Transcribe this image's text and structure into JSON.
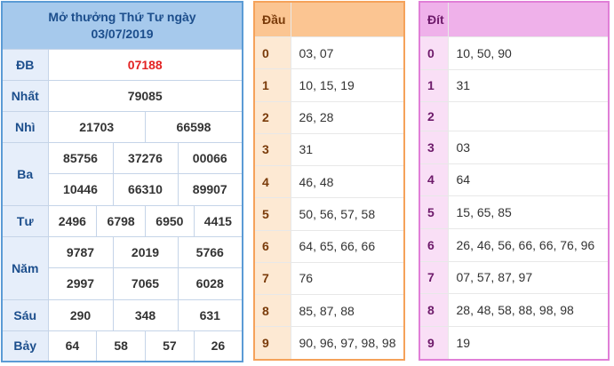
{
  "header": {
    "title_line1": "Mở thưởng Thứ Tư ngày",
    "title_line2": "03/07/2019"
  },
  "prizes": [
    {
      "label": "ĐB",
      "rows": [
        [
          "07188"
        ]
      ]
    },
    {
      "label": "Nhất",
      "rows": [
        [
          "79085"
        ]
      ]
    },
    {
      "label": "Nhì",
      "rows": [
        [
          "21703",
          "66598"
        ]
      ]
    },
    {
      "label": "Ba",
      "rows": [
        [
          "85756",
          "37276",
          "00066"
        ],
        [
          "10446",
          "66310",
          "89907"
        ]
      ]
    },
    {
      "label": "Tư",
      "rows": [
        [
          "2496",
          "6798",
          "6950",
          "4415"
        ]
      ]
    },
    {
      "label": "Năm",
      "rows": [
        [
          "9787",
          "2019",
          "5766"
        ],
        [
          "2997",
          "7065",
          "6028"
        ]
      ]
    },
    {
      "label": "Sáu",
      "rows": [
        [
          "290",
          "348",
          "631"
        ]
      ]
    },
    {
      "label": "Bảy",
      "rows": [
        [
          "64",
          "58",
          "57",
          "26"
        ]
      ]
    }
  ],
  "dau": {
    "title": "Đầu",
    "rows": [
      {
        "head": "0",
        "values": "03, 07"
      },
      {
        "head": "1",
        "values": "10, 15, 19"
      },
      {
        "head": "2",
        "values": "26, 28"
      },
      {
        "head": "3",
        "values": "31"
      },
      {
        "head": "4",
        "values": "46, 48"
      },
      {
        "head": "5",
        "values": "50, 56, 57, 58"
      },
      {
        "head": "6",
        "values": "64, 65, 66, 66"
      },
      {
        "head": "7",
        "values": "76"
      },
      {
        "head": "8",
        "values": "85, 87, 88"
      },
      {
        "head": "9",
        "values": "90, 96, 97, 98, 98"
      }
    ]
  },
  "dit": {
    "title": "Đít",
    "rows": [
      {
        "head": "0",
        "values": "10, 50, 90"
      },
      {
        "head": "1",
        "values": "31"
      },
      {
        "head": "2",
        "values": ""
      },
      {
        "head": "3",
        "values": "03"
      },
      {
        "head": "4",
        "values": "64"
      },
      {
        "head": "5",
        "values": "15, 65, 85"
      },
      {
        "head": "6",
        "values": "26, 46, 56, 66, 66, 76, 96"
      },
      {
        "head": "7",
        "values": "07, 57, 87, 97"
      },
      {
        "head": "8",
        "values": "28, 48, 58, 88, 98, 98"
      },
      {
        "head": "9",
        "values": "19"
      }
    ]
  },
  "colors": {
    "results_border": "#5b9bd5",
    "results_header": "#a6c9ec",
    "special_prize": "#e32222",
    "dau_border": "#f5a25a",
    "dau_header": "#fbc592",
    "dit_border": "#e07fd7",
    "dit_header": "#efb1ea"
  }
}
